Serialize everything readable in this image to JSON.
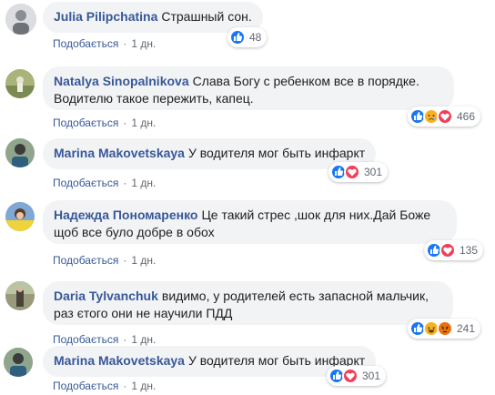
{
  "colors": {
    "author": "#385898",
    "bubble": "#f2f3f5",
    "like_blue": "#1877f2",
    "love_red": "#f33e58",
    "emoji_yellow": "#f7b125"
  },
  "comments": [
    {
      "author": "Julia Pilipchatina",
      "text": "Страшный сон.",
      "like_label": "Подобається",
      "time": "1 дн.",
      "reactions": [
        "like"
      ],
      "reaction_count": "48"
    },
    {
      "author": "Natalya Sinopalnikova",
      "text": "Слава Богу с ребенком все в порядке. Водителю такое пережить, капец.",
      "like_label": "Подобається",
      "time": "1 дн.",
      "reactions": [
        "like",
        "sad",
        "love"
      ],
      "reaction_count": "466"
    },
    {
      "author": "Marina Makovetskaya",
      "text": "У водителя мог быть инфаркт",
      "like_label": "Подобається",
      "time": "1 дн.",
      "reactions": [
        "like",
        "love"
      ],
      "reaction_count": "301"
    },
    {
      "author": "Надежда Пономаренко",
      "text": "Це такий стрес ,шок для них.Дай Боже щоб все було добре в обох",
      "like_label": "Подобається",
      "time": "1 дн.",
      "reactions": [
        "like",
        "love"
      ],
      "reaction_count": "135"
    },
    {
      "author": "Daria Tylvanchuk",
      "text": "видимо, у родителей есть запасной мальчик, раз єтого они не научили ПДД",
      "like_label": "Подобається",
      "time": "1 дн.",
      "reactions": [
        "like",
        "haha",
        "angry"
      ],
      "reaction_count": "241"
    },
    {
      "author": "Marina Makovetskaya",
      "text": "У водителя мог быть инфаркт",
      "like_label": "Подобається",
      "time": "1 дн.",
      "reactions": [
        "like",
        "love"
      ],
      "reaction_count": "301"
    }
  ]
}
